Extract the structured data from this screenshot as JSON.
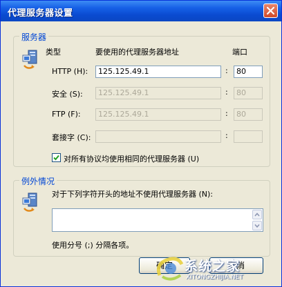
{
  "window": {
    "title": "代理服务器设置"
  },
  "servers": {
    "group_title": "服务器",
    "col_type": "类型",
    "col_address": "要使用的代理服务器地址",
    "col_port": "端口",
    "rows": [
      {
        "label": "HTTP (H):",
        "address": "125.125.49.1",
        "port": "80",
        "disabled": false
      },
      {
        "label": "安全 (S):",
        "address": "125.125.49.1",
        "port": "80",
        "disabled": true
      },
      {
        "label": "FTP (F):",
        "address": "125.125.49.1",
        "port": "80",
        "disabled": true
      },
      {
        "label": "套接字 (C):",
        "address": "",
        "port": "",
        "disabled": true
      }
    ],
    "same_proxy_label": "对所有协议均使用相同的代理服务器 (U)",
    "same_proxy_checked": true
  },
  "exceptions": {
    "group_title": "例外情况",
    "description": "对于下列字符开头的地址不使用代理服务器 (N):",
    "value": "",
    "hint": "使用分号 (;) 分隔各项。"
  },
  "buttons": {
    "ok": "确定",
    "cancel": "取消"
  },
  "watermark": {
    "brand": "系统之家",
    "site": "XITONGZHIJIA.NET"
  },
  "colors": {
    "title_bar": "#0a4ad0",
    "group_title": "#0046d5",
    "face": "#ece9d8"
  }
}
